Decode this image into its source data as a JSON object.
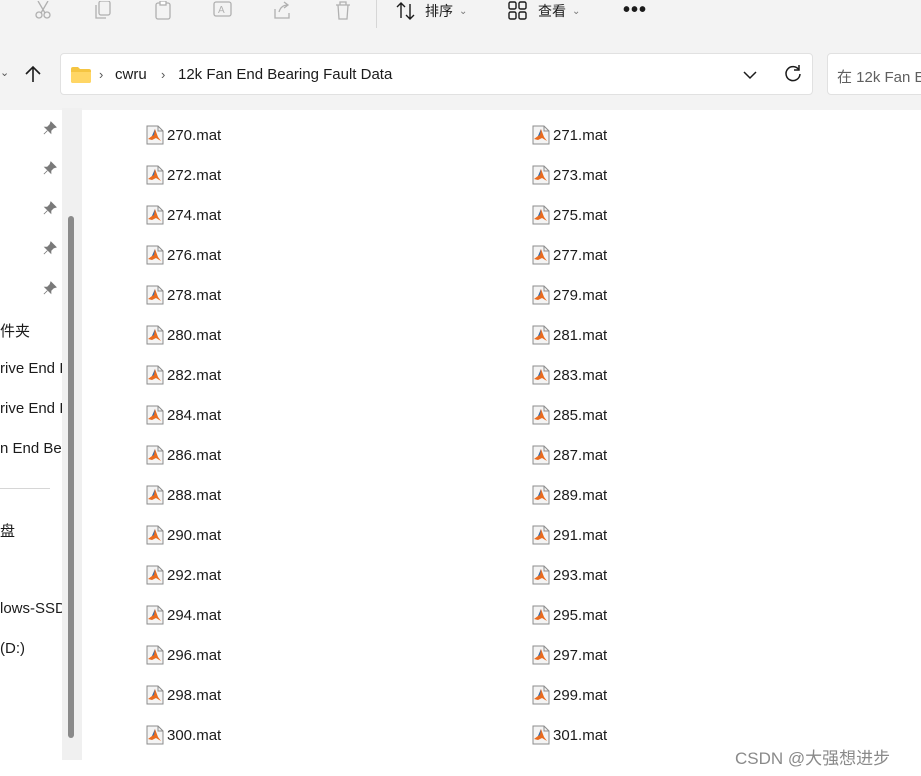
{
  "toolbar": {
    "sort_label": "排序",
    "view_label": "查看",
    "more_label": "•••"
  },
  "address": {
    "crumbs": [
      "cwru",
      "12k Fan End Bearing Fault Data"
    ],
    "search_placeholder": "在 12k Fan E"
  },
  "nav_pane": {
    "items": [
      "件夹",
      "rive End I",
      "rive End I",
      "n End Be",
      "盘",
      "lows-SSD",
      "(D:)"
    ]
  },
  "files": [
    "270.mat",
    "271.mat",
    "272.mat",
    "273.mat",
    "274.mat",
    "275.mat",
    "276.mat",
    "277.mat",
    "278.mat",
    "279.mat",
    "280.mat",
    "281.mat",
    "282.mat",
    "283.mat",
    "284.mat",
    "285.mat",
    "286.mat",
    "287.mat",
    "288.mat",
    "289.mat",
    "290.mat",
    "291.mat",
    "292.mat",
    "293.mat",
    "294.mat",
    "295.mat",
    "296.mat",
    "297.mat",
    "298.mat",
    "299.mat",
    "300.mat",
    "301.mat"
  ],
  "watermark": "CSDN @大强想进步",
  "colors": {
    "chrome_bg": "#f3f3f3",
    "folder_yellow": "#f5c542",
    "matlab_orange": "#e96b1f"
  }
}
